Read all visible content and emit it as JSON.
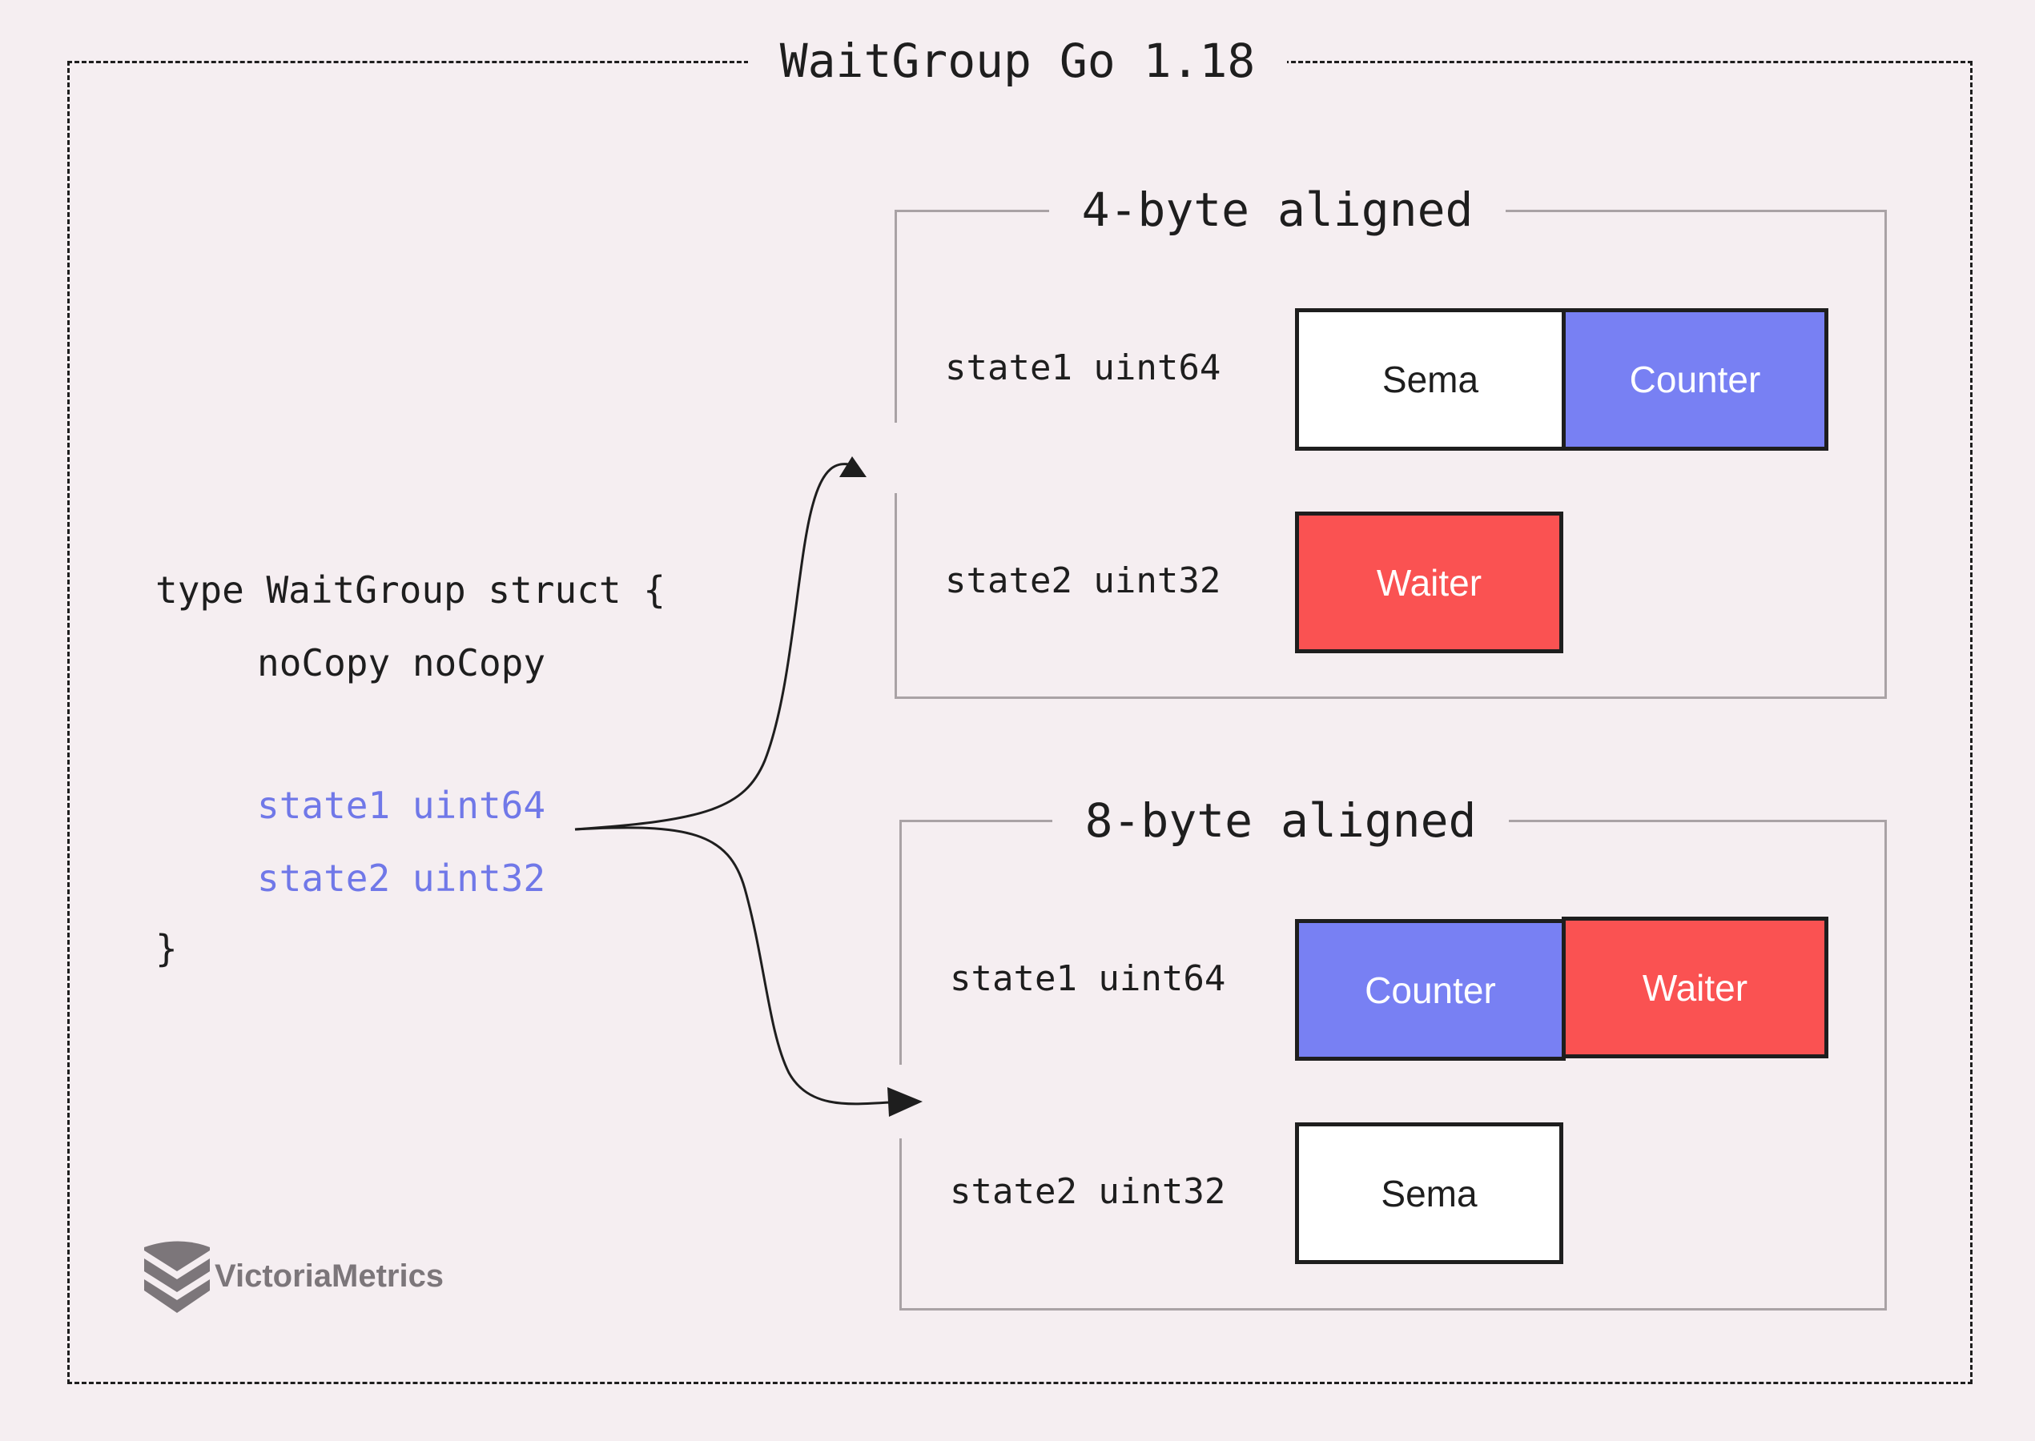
{
  "title": "WaitGroup Go 1.18",
  "code": {
    "line1": "type WaitGroup struct {",
    "line2": "noCopy noCopy",
    "line3": "state1 uint64",
    "line4": "state2 uint32",
    "line5": "}"
  },
  "groups": [
    {
      "title": "4-byte aligned",
      "rows": [
        {
          "label": "state1 uint64",
          "cells": [
            {
              "text": "Sema",
              "color": "#ffffff",
              "text_color": "#1e1e1e"
            },
            {
              "text": "Counter",
              "color": "#7880f3",
              "text_color": "#ffffff"
            }
          ]
        },
        {
          "label": "state2 uint32",
          "cells": [
            {
              "text": "Waiter",
              "color": "#fa5252",
              "text_color": "#ffffff"
            }
          ]
        }
      ]
    },
    {
      "title": "8-byte aligned",
      "rows": [
        {
          "label": "state1 uint64",
          "cells": [
            {
              "text": "Counter",
              "color": "#7880f3",
              "text_color": "#ffffff"
            },
            {
              "text": "Waiter",
              "color": "#fa5252",
              "text_color": "#ffffff"
            }
          ]
        },
        {
          "label": "state2 uint32",
          "cells": [
            {
              "text": "Sema",
              "color": "#ffffff",
              "text_color": "#1e1e1e"
            }
          ]
        }
      ]
    }
  ],
  "logo": {
    "text": "VictoriaMetrics"
  },
  "colors": {
    "background": "#f5eef1",
    "highlight": "#7078e8",
    "counter": "#7880f3",
    "waiter": "#fa5252",
    "sema": "#ffffff",
    "group_border": "#a9a2a5",
    "logo": "#7c767a"
  }
}
